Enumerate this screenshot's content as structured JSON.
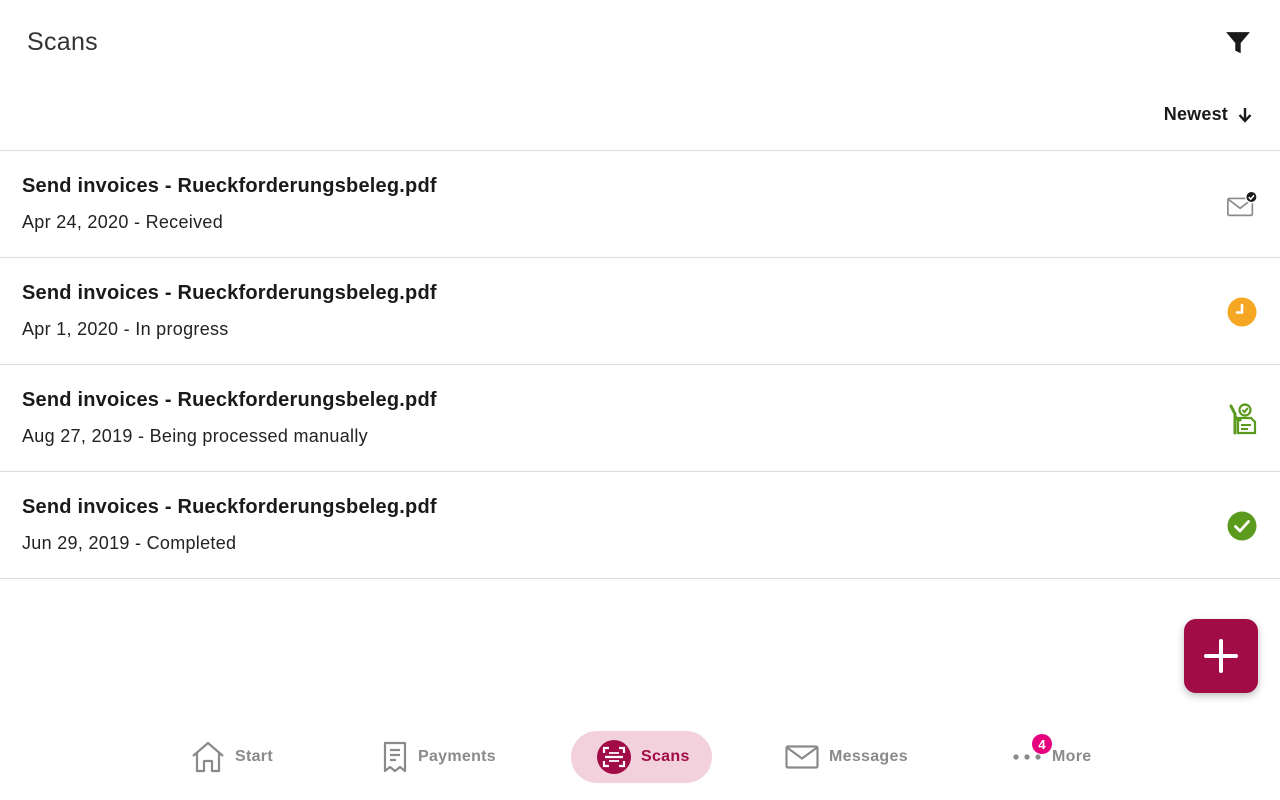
{
  "header": {
    "title": "Scans",
    "filter_icon": "filter-icon"
  },
  "sort": {
    "label": "Newest",
    "icon": "arrow-down-icon"
  },
  "scans": [
    {
      "name": "Send invoices - Rueckforderungsbeleg.pdf",
      "meta": "Apr 24, 2020 - Received",
      "status_icon": "envelope-check-icon"
    },
    {
      "name": "Send invoices - Rueckforderungsbeleg.pdf",
      "meta": "Apr 1, 2020 - In progress",
      "status_icon": "clock-icon",
      "status_color": "#f5a623"
    },
    {
      "name": "Send invoices - Rueckforderungsbeleg.pdf",
      "meta": "Aug 27, 2019 - Being processed manually",
      "status_icon": "manual-processing-icon",
      "status_color": "#5a9a1c"
    },
    {
      "name": "Send invoices - Rueckforderungsbeleg.pdf",
      "meta": "Jun 29, 2019 - Completed",
      "status_icon": "check-circle-icon",
      "status_color": "#5a9a1c"
    }
  ],
  "fab": {
    "icon": "plus-icon",
    "color": "#a10b46"
  },
  "nav": {
    "accent": "#a10b46",
    "items": [
      {
        "label": "Start",
        "icon": "home-icon"
      },
      {
        "label": "Payments",
        "icon": "receipt-icon"
      },
      {
        "label": "Scans",
        "icon": "scan-icon",
        "active": true
      },
      {
        "label": "Messages",
        "icon": "envelope-icon"
      },
      {
        "label": "More",
        "icon": "more-dots-icon",
        "badge": "4"
      }
    ]
  }
}
